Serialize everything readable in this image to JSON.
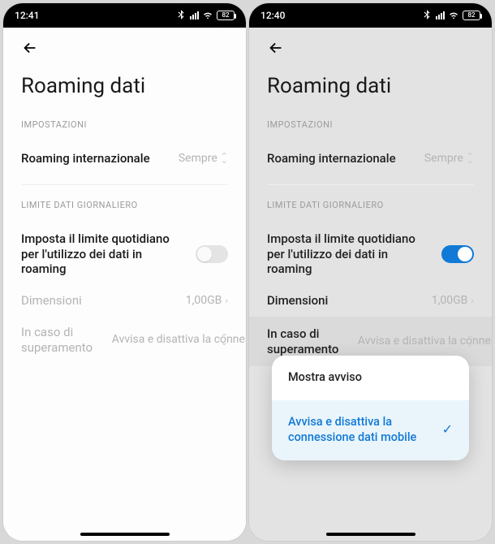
{
  "left": {
    "status": {
      "time": "12:41",
      "battery": "82"
    },
    "page_title": "Roaming dati",
    "section_settings": "IMPOSTAZIONI",
    "roaming_intl": {
      "label": "Roaming internazionale",
      "value": "Sempre"
    },
    "section_daily": "LIMITE DATI GIORNALIERO",
    "daily_limit": {
      "label": "Imposta il limite quotidiano per l'utilizzo dei dati in roaming",
      "toggled": false
    },
    "size": {
      "label": "Dimensioni",
      "value": "1,00GB"
    },
    "overlimit": {
      "label": "In caso di superamento",
      "value": "Avvisa e disattiva la connessione dati mobile"
    }
  },
  "right": {
    "status": {
      "time": "12:40",
      "battery": "82"
    },
    "page_title": "Roaming dati",
    "section_settings": "IMPOSTAZIONI",
    "roaming_intl": {
      "label": "Roaming internazionale",
      "value": "Sempre"
    },
    "section_daily": "LIMITE DATI GIORNALIERO",
    "daily_limit": {
      "label": "Imposta il limite quotidiano per l'utilizzo dei dati in roaming",
      "toggled": true
    },
    "size": {
      "label": "Dimensioni",
      "value": "1,00GB"
    },
    "overlimit": {
      "label": "In caso di superamento",
      "value": "Avvisa e disattiva la connessione dati mobile"
    },
    "popup": {
      "option1": "Mostra avviso",
      "option2": "Avvisa e disattiva la connessione dati mobile"
    }
  }
}
